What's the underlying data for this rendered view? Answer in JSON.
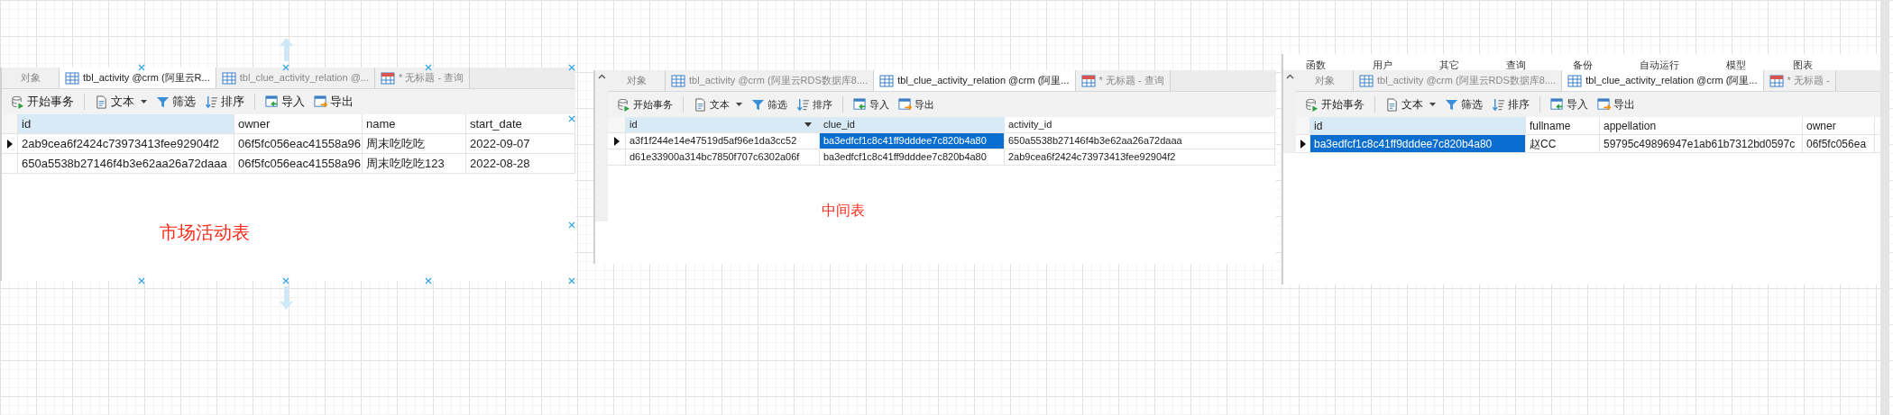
{
  "panels": [
    {
      "tabs": [
        {
          "label": "对象",
          "kind": "objects",
          "selected": false
        },
        {
          "label": "tbl_activity @crm (阿里云R...",
          "kind": "table",
          "selected": true
        },
        {
          "label": "tbl_clue_activity_relation @...",
          "kind": "table",
          "selected": false
        },
        {
          "label": "* 无标题 - 查询",
          "kind": "query",
          "selected": false
        }
      ],
      "toolbar": [
        {
          "label": "开始事务",
          "kind": "transaction"
        },
        {
          "label": "文本",
          "kind": "text"
        },
        {
          "label": "筛选",
          "kind": "filter"
        },
        {
          "label": "排序",
          "kind": "sort"
        },
        {
          "label": "导入",
          "kind": "import"
        },
        {
          "label": "导出",
          "kind": "export"
        }
      ],
      "columns": [
        {
          "name": "id",
          "highlighted": true,
          "menu": false
        },
        {
          "name": "owner",
          "highlighted": false,
          "menu": false
        },
        {
          "name": "name",
          "highlighted": false,
          "menu": false
        },
        {
          "name": "start_date",
          "highlighted": false,
          "menu": false
        }
      ],
      "rows": [
        {
          "current": true,
          "cells": [
            {
              "text": "2ab9cea6f2424c73973413fee92904f2",
              "selected": false
            },
            {
              "text": "06f5fc056eac41558a96",
              "selected": false
            },
            {
              "text": "周末吃吃吃",
              "selected": false
            },
            {
              "text": "2022-09-07",
              "selected": false
            }
          ]
        },
        {
          "current": false,
          "cells": [
            {
              "text": "650a5538b27146f4b3e62aa26a72daaa",
              "selected": false
            },
            {
              "text": "06f5fc056eac41558a96",
              "selected": false
            },
            {
              "text": "周末吃吃吃123",
              "selected": false
            },
            {
              "text": "2022-08-28",
              "selected": false
            }
          ]
        }
      ],
      "caption": "市场活动表"
    },
    {
      "tabs": [
        {
          "label": "对象",
          "kind": "objects",
          "selected": false
        },
        {
          "label": "tbl_activity @crm (阿里云RDS数据库8....",
          "kind": "table",
          "selected": false
        },
        {
          "label": "tbl_clue_activity_relation @crm (阿里...",
          "kind": "table",
          "selected": true
        },
        {
          "label": "* 无标题 - 查询",
          "kind": "query",
          "selected": false
        }
      ],
      "toolbar": [
        {
          "label": "开始事务",
          "kind": "transaction"
        },
        {
          "label": "文本",
          "kind": "text"
        },
        {
          "label": "筛选",
          "kind": "filter"
        },
        {
          "label": "排序",
          "kind": "sort"
        },
        {
          "label": "导入",
          "kind": "import"
        },
        {
          "label": "导出",
          "kind": "export"
        }
      ],
      "columns": [
        {
          "name": "id",
          "highlighted": true,
          "menu": true
        },
        {
          "name": "clue_id",
          "highlighted": true,
          "menu": false
        },
        {
          "name": "activity_id",
          "highlighted": false,
          "menu": false
        }
      ],
      "rows": [
        {
          "current": true,
          "cells": [
            {
              "text": "a3f1f244e14e47519d5af96e1da3cc52",
              "selected": false
            },
            {
              "text": "ba3edfcf1c8c41ff9dddee7c820b4a80",
              "selected": true
            },
            {
              "text": "650a5538b27146f4b3e62aa26a72daaa",
              "selected": false
            }
          ]
        },
        {
          "current": false,
          "cells": [
            {
              "text": "d61e33900a314bc7850f707c6302a06f",
              "selected": false
            },
            {
              "text": "ba3edfcf1c8c41ff9dddee7c820b4a80",
              "selected": false
            },
            {
              "text": "2ab9cea6f2424c73973413fee92904f2",
              "selected": false
            }
          ]
        }
      ],
      "caption": "中间表"
    },
    {
      "menu": [
        "函数",
        "用户",
        "其它",
        "查询",
        "备份",
        "自动运行",
        "模型",
        "图表"
      ],
      "tabs": [
        {
          "label": "对象",
          "kind": "objects",
          "selected": false
        },
        {
          "label": "tbl_activity @crm (阿里云RDS数据库8....",
          "kind": "table",
          "selected": false
        },
        {
          "label": "tbl_clue_activity_relation @crm (阿里...",
          "kind": "table",
          "selected": true
        },
        {
          "label": "* 无标题 -",
          "kind": "query",
          "selected": false
        }
      ],
      "toolbar": [
        {
          "label": "开始事务",
          "kind": "transaction"
        },
        {
          "label": "文本",
          "kind": "text"
        },
        {
          "label": "筛选",
          "kind": "filter"
        },
        {
          "label": "排序",
          "kind": "sort"
        },
        {
          "label": "导入",
          "kind": "import"
        },
        {
          "label": "导出",
          "kind": "export"
        }
      ],
      "columns": [
        {
          "name": "id",
          "highlighted": true,
          "menu": false
        },
        {
          "name": "fullname",
          "highlighted": false,
          "menu": false
        },
        {
          "name": "appellation",
          "highlighted": false,
          "menu": false
        },
        {
          "name": "owner",
          "highlighted": false,
          "menu": false
        }
      ],
      "rows": [
        {
          "current": true,
          "cells": [
            {
              "text": "ba3edfcf1c8c41ff9dddee7c820b4a80",
              "selected": true
            },
            {
              "text": "赵CC",
              "selected": false
            },
            {
              "text": "59795c49896947e1ab61b7312bd0597c",
              "selected": false
            },
            {
              "text": "06f5fc056ea",
              "selected": false
            }
          ]
        }
      ]
    }
  ]
}
